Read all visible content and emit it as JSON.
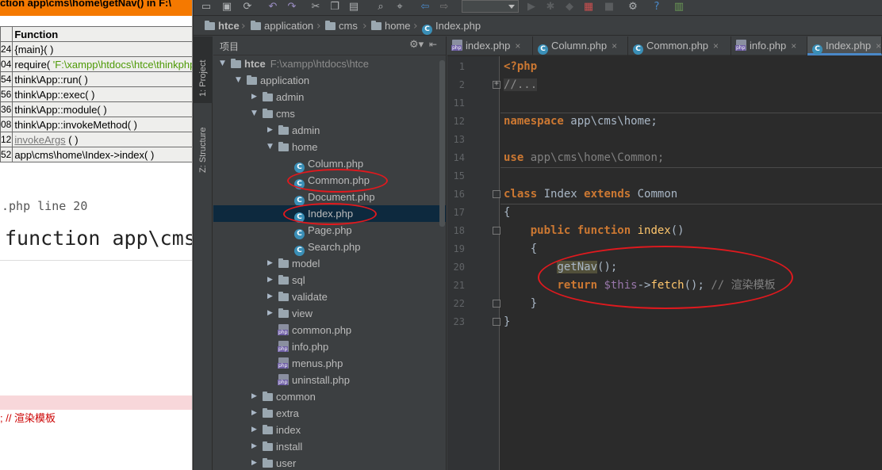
{
  "browser": {
    "error_title": "ction app\\cms\\home\\getNav() in F:\\",
    "call_stack": {
      "header": "Function",
      "rows": [
        {
          "num": "24",
          "fn": "{main}( )"
        },
        {
          "num": "04",
          "fn_prefix": "require( ",
          "fn_str": "'F:\\xampp\\htdocs\\htce\\thinkphp\\start.php'"
        },
        {
          "num": "54",
          "fn": "think\\App::run( )"
        },
        {
          "num": "56",
          "fn": "think\\App::exec( )"
        },
        {
          "num": "36",
          "fn": "think\\App::module( )"
        },
        {
          "num": "08",
          "fn": "think\\App::invokeMethod( )"
        },
        {
          "num": "12",
          "fn": "invokeArgs",
          "fn_suffix": " ( )"
        },
        {
          "num": "52",
          "fn": "app\\cms\\home\\Index->index( )"
        }
      ]
    },
    "file_line": ".php line 20",
    "big_function": "function app\\cms",
    "comment": "; // 渲染模板"
  },
  "toolbar": {
    "icons": [
      "folder-open-icon",
      "save-icon",
      "sync-icon",
      "undo-icon",
      "redo-icon",
      "cut-icon",
      "copy-icon",
      "paste-icon",
      "find-icon",
      "replace-icon",
      "back-icon",
      "forward-icon",
      "run-config-combo",
      "run-icon",
      "debug-icon",
      "coverage-icon",
      "vcs-icon",
      "stop-icon",
      "settings-icon",
      "help-icon",
      "plugin-icon"
    ]
  },
  "navbar": {
    "crumbs": [
      {
        "label": "htce",
        "bold": true,
        "icon": "folder"
      },
      {
        "label": "application",
        "icon": "folder"
      },
      {
        "label": "cms",
        "icon": "folder"
      },
      {
        "label": "home",
        "icon": "folder"
      },
      {
        "label": "Index.php",
        "icon": "class"
      }
    ]
  },
  "side_tabs": {
    "project": "1: Project",
    "structure": "Z: Structure"
  },
  "project": {
    "header": "项目",
    "root": {
      "name": "htce",
      "path": "F:\\xampp\\htdocs\\htce"
    },
    "tree": [
      {
        "label": "application",
        "depth": 1,
        "type": "folder",
        "expanded": true
      },
      {
        "label": "admin",
        "depth": 2,
        "type": "folder",
        "expanded": false
      },
      {
        "label": "cms",
        "depth": 2,
        "type": "folder",
        "expanded": true
      },
      {
        "label": "admin",
        "depth": 3,
        "type": "folder",
        "expanded": false
      },
      {
        "label": "home",
        "depth": 3,
        "type": "folder",
        "expanded": true
      },
      {
        "label": "Column.php",
        "depth": 4,
        "type": "class"
      },
      {
        "label": "Common.php",
        "depth": 4,
        "type": "class"
      },
      {
        "label": "Document.php",
        "depth": 4,
        "type": "class"
      },
      {
        "label": "Index.php",
        "depth": 4,
        "type": "class",
        "selected": true
      },
      {
        "label": "Page.php",
        "depth": 4,
        "type": "class"
      },
      {
        "label": "Search.php",
        "depth": 4,
        "type": "class"
      },
      {
        "label": "model",
        "depth": 3,
        "type": "folder",
        "expanded": false
      },
      {
        "label": "sql",
        "depth": 3,
        "type": "folder",
        "expanded": false
      },
      {
        "label": "validate",
        "depth": 3,
        "type": "folder",
        "expanded": false
      },
      {
        "label": "view",
        "depth": 3,
        "type": "folder",
        "expanded": false
      },
      {
        "label": "common.php",
        "depth": 3,
        "type": "php"
      },
      {
        "label": "info.php",
        "depth": 3,
        "type": "php"
      },
      {
        "label": "menus.php",
        "depth": 3,
        "type": "php"
      },
      {
        "label": "uninstall.php",
        "depth": 3,
        "type": "php"
      },
      {
        "label": "common",
        "depth": 2,
        "type": "folder",
        "expanded": false
      },
      {
        "label": "extra",
        "depth": 2,
        "type": "folder",
        "expanded": false
      },
      {
        "label": "index",
        "depth": 2,
        "type": "folder",
        "expanded": false
      },
      {
        "label": "install",
        "depth": 2,
        "type": "folder",
        "expanded": false
      },
      {
        "label": "user",
        "depth": 2,
        "type": "folder",
        "expanded": false
      }
    ]
  },
  "editor": {
    "tabs": [
      {
        "label": "index.php",
        "icon": "php"
      },
      {
        "label": "Column.php",
        "icon": "class"
      },
      {
        "label": "Common.php",
        "icon": "class"
      },
      {
        "label": "info.php",
        "icon": "php"
      },
      {
        "label": "Index.php",
        "icon": "class",
        "active": true
      }
    ],
    "lines": [
      {
        "n": "1",
        "text": "<?php"
      },
      {
        "n": "2",
        "text": "//..."
      },
      {
        "n": "11",
        "text": ""
      },
      {
        "n": "12",
        "kw": "namespace",
        "rest": " app\\cms\\home;"
      },
      {
        "n": "13",
        "text": ""
      },
      {
        "n": "14",
        "kw": "use",
        "rest": " app\\cms\\home\\Common;"
      },
      {
        "n": "15",
        "text": ""
      },
      {
        "n": "16",
        "kw": "class",
        "mid": " Index ",
        "kw2": "extends",
        "rest": " Common"
      },
      {
        "n": "17",
        "text": "{"
      },
      {
        "n": "18",
        "kw": "public function",
        "fn": "index",
        "rest": "()"
      },
      {
        "n": "19",
        "text": "{"
      },
      {
        "n": "20",
        "fn": "getNav",
        "rest": "();"
      },
      {
        "n": "21",
        "kw": "return",
        "var": "$this",
        "arrow": "->",
        "fn": "fetch",
        "rest": "(); ",
        "comment": "// 渲染模板"
      },
      {
        "n": "22",
        "text": "}"
      },
      {
        "n": "23",
        "text": "}"
      }
    ]
  },
  "annotation_color": "#e0191e"
}
